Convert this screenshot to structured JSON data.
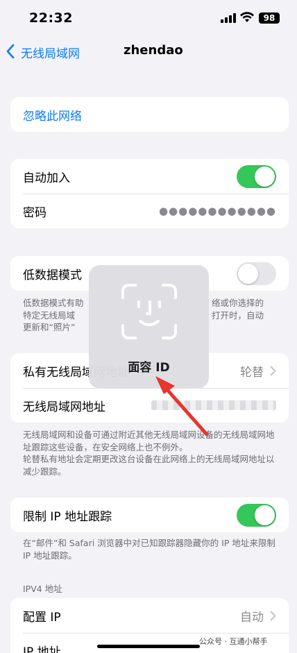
{
  "status_bar": {
    "time": "22:32",
    "battery": "98"
  },
  "nav": {
    "back_label": "无线局域网",
    "title": "zhendao"
  },
  "forget": {
    "label": "忽略此网络"
  },
  "auto_join": {
    "label": "自动加入",
    "on": true
  },
  "password": {
    "label": "密码",
    "masked": "●●●●●●●●●●●●"
  },
  "low_data": {
    "label": "低数据模式",
    "on": false,
    "footnote_line1": "低数据模式有助",
    "footnote_line1_right": "络或你选择的",
    "footnote_line2": "特定无线局域",
    "footnote_line2_right": "打开时，自动",
    "footnote_line3": "更新和“照片”",
    "footnote_line3_right": "。"
  },
  "private_address": {
    "label": "私有无线局域网地址",
    "value": "轮替"
  },
  "wlan_address": {
    "label": "无线局域网地址"
  },
  "address_footnote": "无线局域网和设备可通过附近其他无线局域网设备的无线局域网地址跟踪这些设备，在安全网络上也不例外。\n轮替私有地址会定期更改这台设备在此网络上的无线局域网地址以减少跟踪。",
  "limit_ip": {
    "label": "限制 IP 地址跟踪",
    "on": true,
    "footnote": "在“邮件”和 Safari 浏览器中对已知跟踪器隐藏你的 IP 地址来限制 IP 地址跟踪。"
  },
  "ipv4": {
    "header": "IPV4 地址",
    "configure_label": "配置 IP",
    "configure_value": "自动",
    "ip_label": "IP 地址"
  },
  "faceid": {
    "label": "面容 ID"
  },
  "watermark": "公众号 · 互通小帮手",
  "colors": {
    "accent": "#0a7aff",
    "toggle_on": "#34c759",
    "arrow": "#e8352e"
  }
}
